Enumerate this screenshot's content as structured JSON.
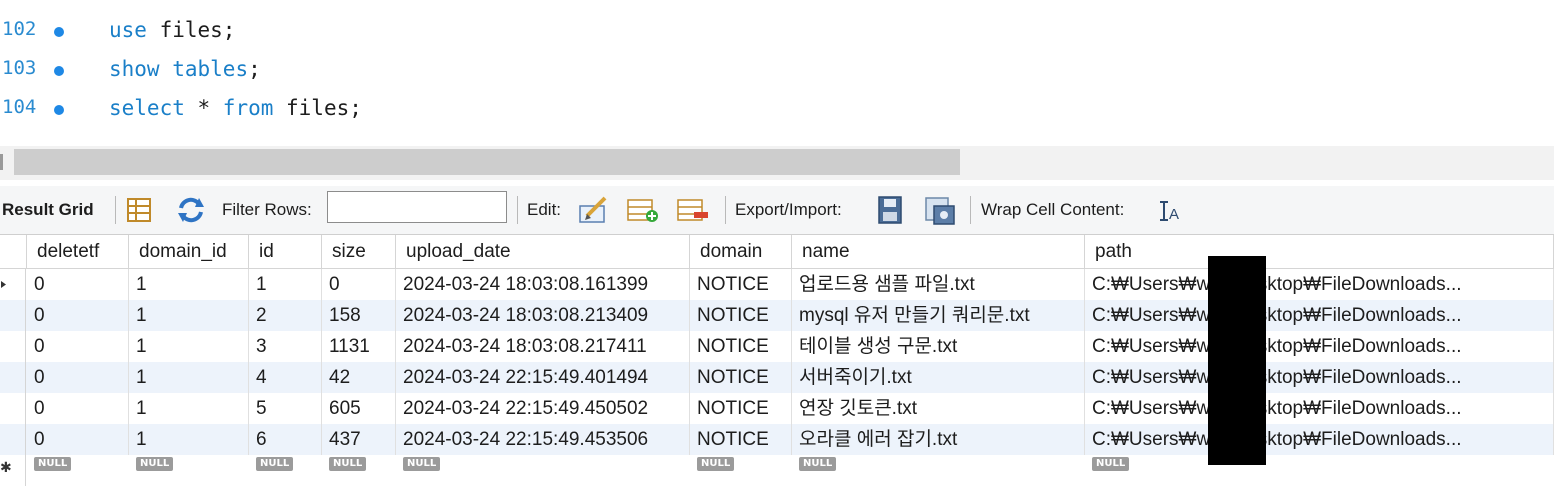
{
  "editor": {
    "lines": [
      {
        "number": "102",
        "parts": [
          {
            "t": "use",
            "k": 1
          },
          {
            "t": " files;",
            "k": 0
          }
        ]
      },
      {
        "number": "103",
        "parts": [
          {
            "t": "show",
            "k": 1
          },
          {
            "t": " ",
            "k": 0
          },
          {
            "t": "tables",
            "k": 1
          },
          {
            "t": ";",
            "k": 0
          }
        ]
      },
      {
        "number": "104",
        "parts": [
          {
            "t": "select",
            "k": 1
          },
          {
            "t": " * ",
            "k": 0
          },
          {
            "t": "from",
            "k": 1
          },
          {
            "t": " files;",
            "k": 0
          }
        ]
      }
    ]
  },
  "toolbar": {
    "result_grid_label": "Result Grid",
    "filter_rows_label": "Filter Rows:",
    "filter_rows_value": "",
    "edit_label": "Edit:",
    "export_import_label": "Export/Import:",
    "wrap_cell_content_label": "Wrap Cell Content:"
  },
  "grid": {
    "columns": [
      "deletetf",
      "domain_id",
      "id",
      "size",
      "upload_date",
      "domain",
      "name",
      "path"
    ],
    "rows": [
      [
        "0",
        "1",
        "1",
        "0",
        "2024-03-24 18:03:08.161399",
        "NOTICE",
        "업로드용 샘플 파일.txt",
        "C:₩Users₩w          ₩Desktop₩FileDownloads..."
      ],
      [
        "0",
        "1",
        "2",
        "158",
        "2024-03-24 18:03:08.213409",
        "NOTICE",
        "mysql 유저 만들기 쿼리문.txt",
        "C:₩Users₩w          ₩Desktop₩FileDownloads..."
      ],
      [
        "0",
        "1",
        "3",
        "1131",
        "2024-03-24 18:03:08.217411",
        "NOTICE",
        "테이블 생성 구문.txt",
        "C:₩Users₩w          ₩Desktop₩FileDownloads..."
      ],
      [
        "0",
        "1",
        "4",
        "42",
        "2024-03-24 22:15:49.401494",
        "NOTICE",
        "서버죽이기.txt",
        "C:₩Users₩w          ₩Desktop₩FileDownloads..."
      ],
      [
        "0",
        "1",
        "5",
        "605",
        "2024-03-24 22:15:49.450502",
        "NOTICE",
        "연장 깃토큰.txt",
        "C:₩Users₩w          ₩Desktop₩FileDownloads..."
      ],
      [
        "0",
        "1",
        "6",
        "437",
        "2024-03-24 22:15:49.453506",
        "NOTICE",
        "오라클 에러 잡기.txt",
        "C:₩Users₩w          ₩Desktop₩FileDownloads..."
      ]
    ],
    "null_label": "NULL"
  },
  "colors": {
    "keyword": "#1a7fc8",
    "line_number": "#2a8bd0",
    "breakpoint_dot": "#1e88e5",
    "alt_row": "#edf3fb"
  },
  "icons": [
    "grid-form-icon",
    "refresh-icon",
    "edit-cell-icon",
    "insert-row-icon",
    "delete-row-icon",
    "export-icon",
    "import-icon",
    "wrap-text-icon"
  ]
}
